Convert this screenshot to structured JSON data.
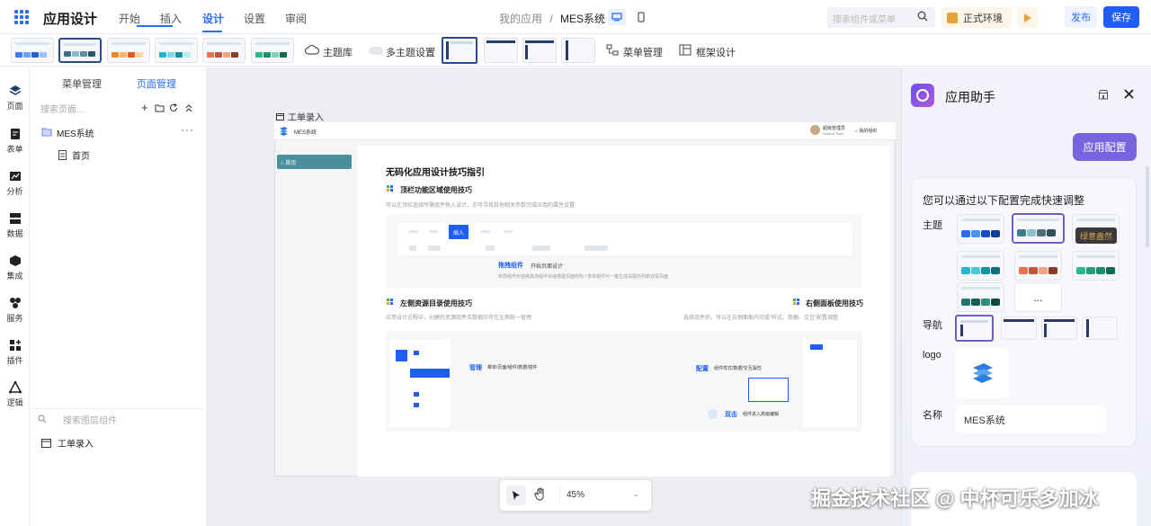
{
  "header": {
    "app_title": "应用设计",
    "menu": [
      "开始",
      "插入",
      "设计",
      "设置",
      "审阅"
    ],
    "active_menu": "设计",
    "breadcrumb_parent": "我的应用",
    "breadcrumb_sep": "/",
    "breadcrumb_current": "MES系统",
    "search_placeholder": "搜索组件或菜单",
    "env_label": "正式环境",
    "publish_label": "发布",
    "save_label": "保存"
  },
  "theme_strip": {
    "theme_lib": "主题库",
    "multi_theme": "多主题设置",
    "menu_manage": "菜单管理",
    "frame_design": "框架设计"
  },
  "rail": [
    "页面",
    "表单",
    "分析",
    "数据",
    "集成",
    "服务",
    "插件",
    "逻辑"
  ],
  "page_panel": {
    "tabs": [
      "菜单管理",
      "页面管理"
    ],
    "active_tab": "页面管理",
    "search_placeholder": "搜索页面...",
    "tree": [
      {
        "label": "MES系统",
        "type": "folder"
      },
      {
        "label": "首页",
        "type": "page"
      }
    ],
    "layer_search_placeholder": "搜索图层组件",
    "layers": [
      {
        "label": "工单录入"
      }
    ]
  },
  "canvas": {
    "frame_label": "工单录入",
    "preview": {
      "app_name": "MES系统",
      "user_name": "超级管理员",
      "user_sub": "Default Team",
      "my_org": "我的组织",
      "side_item": "首页",
      "doc_title": "无码化应用设计技巧指引",
      "sec1_title": "顶栏功能区域使用技巧",
      "sec1_desc": "可以在顶栏选择所需组件拖入设计，亦可寻找其他相关参数完成应用的属性设置",
      "insert_label": "插入",
      "drag_title": "拖拽组件",
      "drag_sub": "开始页面设计",
      "drag_desc": "布局组件可容纳其他组件快速搭建页面结构 / 表单组件可一键生成关联的列表详情页面",
      "sec2_title": "左侧资源目录使用技巧",
      "sec2_desc": "应用设计过程中，创建的资源组件及数据均可在左侧统一管理",
      "sec3_title": "右侧面板使用技巧",
      "sec3_desc": "选择组件后，可以在右侧面板内完成“样式、数据、交互”配置调整",
      "manage_title": "管理",
      "manage_desc": "菜单/页面/组件/数据/插件",
      "config_title": "配置",
      "config_desc": "组件样式/数据/交互属性",
      "dbl_title": "双击",
      "dbl_desc": "组件进入高级编辑"
    },
    "zoom": "45%"
  },
  "assistant": {
    "title": "应用助手",
    "config_button": "应用配置",
    "intro": "您可以通过以下配置完成快速调整",
    "theme_label": "主题",
    "nav_label": "导航",
    "logo_label": "logo",
    "name_label": "名称",
    "name_value": "MES系统",
    "tooltip": "绿意盎然",
    "more": "..."
  },
  "watermark": "掘金技术社区 @ 中杯可乐多加冰",
  "colors": {
    "primary": "#1f5ef5",
    "assistant_accent": "#7a63e0",
    "preview_side": "#4b8f9c"
  }
}
